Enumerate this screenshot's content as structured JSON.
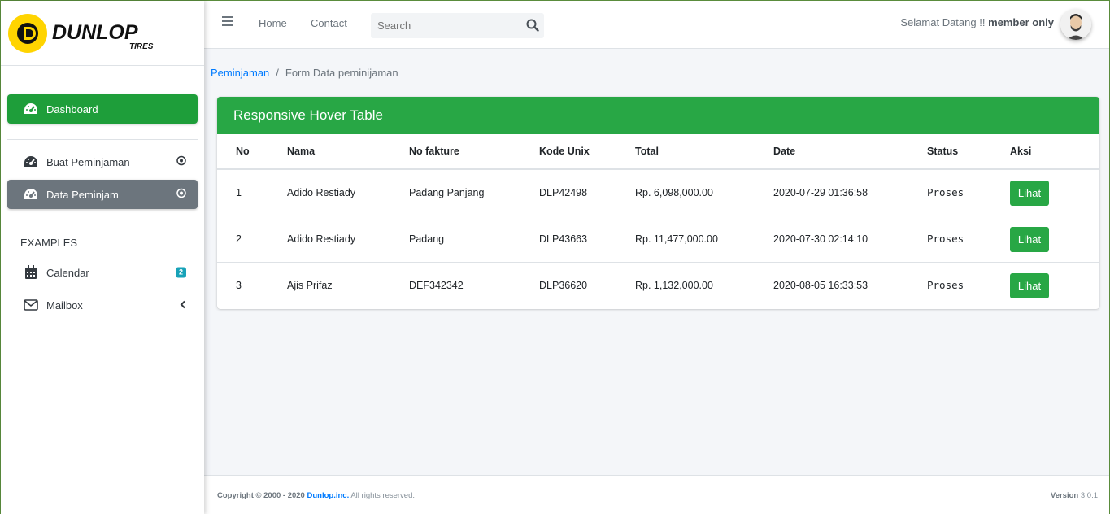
{
  "brand": {
    "name": "DUNLOP",
    "sub": "TIRES"
  },
  "sidebar": {
    "items": [
      {
        "label": "Dashboard",
        "icon": "tachometer-icon"
      },
      {
        "label": "Buat Peminjaman",
        "icon": "tachometer-icon"
      },
      {
        "label": "Data Peminjam",
        "icon": "tachometer-icon"
      }
    ],
    "section_header": "EXAMPLES",
    "examples": [
      {
        "label": "Calendar",
        "icon": "calendar-icon",
        "badge": "2"
      },
      {
        "label": "Mailbox",
        "icon": "envelope-icon"
      }
    ]
  },
  "topbar": {
    "home": "Home",
    "contact": "Contact",
    "search_placeholder": "Search",
    "welcome_text": "Selamat Datang !!",
    "welcome_user": "member only"
  },
  "breadcrumb": {
    "parent": "Peminjaman",
    "separator": "/",
    "current": "Form Data peminijaman"
  },
  "card": {
    "title": "Responsive Hover Table",
    "columns": [
      "No",
      "Nama",
      "No fakture",
      "Kode Unix",
      "Total",
      "Date",
      "Status",
      "Aksi"
    ],
    "rows": [
      {
        "no": "1",
        "nama": "Adido Restiady",
        "fakture": "Padang Panjang",
        "kode": "DLP42498",
        "total": "Rp. 6,098,000.00",
        "date": "2020-07-29 01:36:58",
        "status": "Proses",
        "action": "Lihat"
      },
      {
        "no": "2",
        "nama": "Adido Restiady",
        "fakture": "Padang",
        "kode": "DLP43663",
        "total": "Rp. 11,477,000.00",
        "date": "2020-07-30 02:14:10",
        "status": "Proses",
        "action": "Lihat"
      },
      {
        "no": "3",
        "nama": "Ajis Prifaz",
        "fakture": "DEF342342",
        "kode": "DLP36620",
        "total": "Rp. 1,132,000.00",
        "date": "2020-08-05 16:33:53",
        "status": "Proses",
        "action": "Lihat"
      }
    ]
  },
  "footer": {
    "copyright": "Copyright © 2000 - 2020",
    "company": "Dunlop.inc.",
    "rights": "All rights reserved.",
    "version_label": "Version",
    "version": "3.0.1"
  },
  "colors": {
    "primary_green": "#28a745",
    "active_gray": "#6c757d",
    "link_blue": "#007bff",
    "badge_teal": "#17a2b8"
  }
}
